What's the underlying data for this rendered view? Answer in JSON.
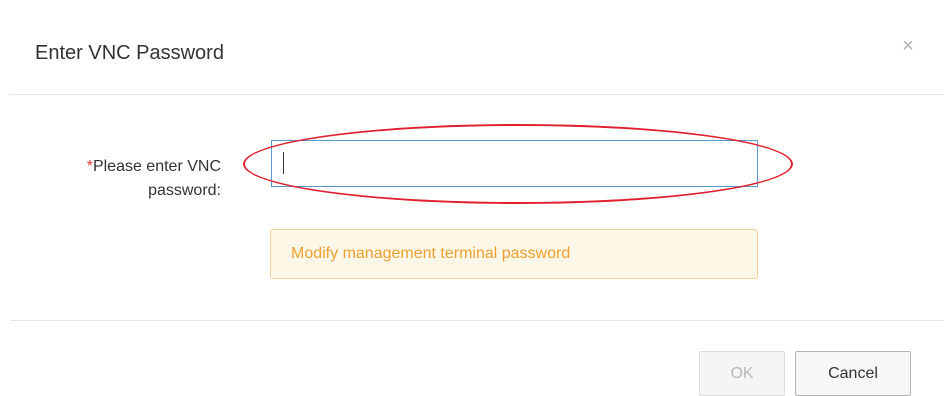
{
  "dialog": {
    "title": "Enter VNC Password",
    "close_icon": "×"
  },
  "form": {
    "required_marker": "*",
    "label_line1": "Please enter VNC",
    "label_line2": "password:",
    "password_value": "",
    "hint_link": "Modify management terminal password"
  },
  "buttons": {
    "ok_label": "OK",
    "cancel_label": "Cancel"
  },
  "colors": {
    "highlight_ellipse": "#e0202f",
    "input_focus_border": "#5b9bd5",
    "hint_text": "#f0a030",
    "hint_background": "#fef6e6"
  },
  "icons": {
    "close": "close-icon"
  }
}
